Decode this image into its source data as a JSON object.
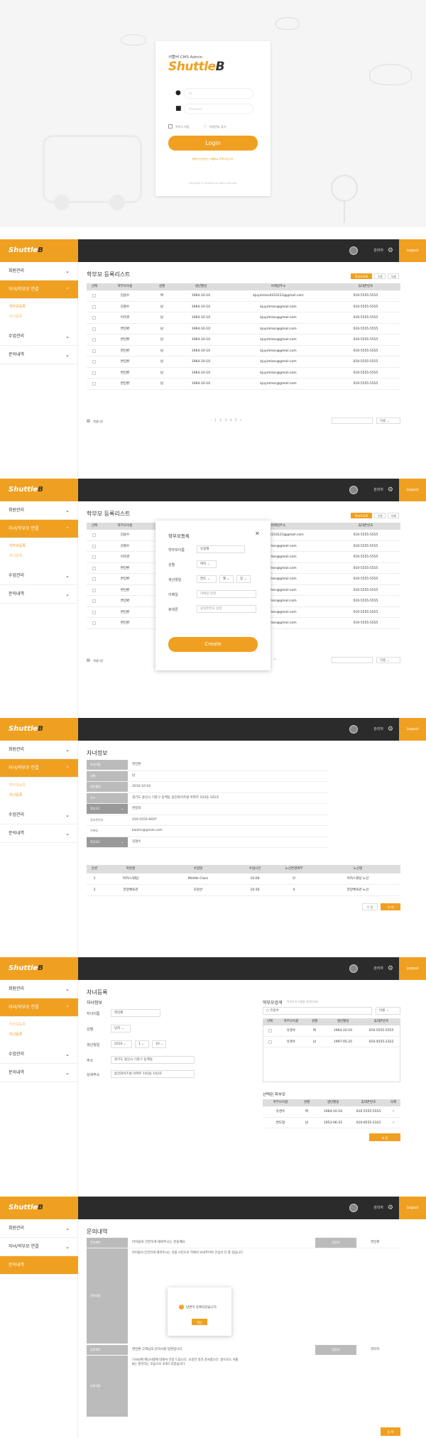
{
  "login": {
    "subtitle": "셔틀버 CMS Admin",
    "logo_a": "Shuttle",
    "logo_b": "B",
    "id_placeholder": "ID",
    "pw_placeholder": "Password",
    "remember": "아이디 저장",
    "find": "비밀번호 찾기",
    "button": "Login",
    "notice": "회원가입 문의는 셔틀B로 부탁드립니다.",
    "footer": "Copyright © ShuttleB All rights reserved."
  },
  "header": {
    "logo_a": "Shuttle",
    "logo_b": "B",
    "admin": "관리자",
    "logout": "Logout"
  },
  "sidebar": {
    "members": "회원관리",
    "link": "자녀/학부모 연결",
    "sub_parent": "학부모등록",
    "sub_child": "자녀등록",
    "classes": "수업관리",
    "inquiry": "문의내역"
  },
  "parents": {
    "title": "학부모 등록리스트",
    "btn_register": "학부모등록",
    "btn_edit": "수정",
    "btn_delete": "삭제",
    "columns": [
      "선택",
      "학부모이름",
      "성별",
      "생년월일",
      "이메일주소",
      "휴대폰번호"
    ],
    "rows": [
      [
        "김용수",
        "여",
        "1964-10-10",
        "kjuyimlsss0210123@gmail.com",
        "010-5555-5555"
      ],
      [
        "김철수",
        "남",
        "1964-10-10",
        "kjuyimlsss@gmail.com",
        "010-5555-5555"
      ],
      [
        "이하경",
        "남",
        "1964-10-10",
        "kjuyimlsss@gmail.com",
        "010-5555-5555"
      ],
      [
        "변민환",
        "남",
        "1964-10-10",
        "kjuyimlsss@gmail.com",
        "010-5555-5555"
      ],
      [
        "변민환",
        "남",
        "1964-10-10",
        "kjuyimlsss@gmail.com",
        "010-5555-5555"
      ],
      [
        "변민환",
        "남",
        "1964-10-10",
        "kjuyimlsss@gmail.com",
        "010-5555-5555"
      ],
      [
        "변민환",
        "남",
        "1964-10-10",
        "kjuyimlsss@gmail.com",
        "010-5555-5555"
      ],
      [
        "변민환",
        "남",
        "1964-10-10",
        "kjuyimlsss@gmail.com",
        "010-5555-5555"
      ],
      [
        "변민환",
        "남",
        "1964-10-10",
        "kjuyimlsss@gmail.com",
        "010-5555-5555"
      ]
    ],
    "excel": "엑셀다운",
    "pages": [
      "‹",
      "1",
      "2",
      "3",
      "4",
      "5",
      "›"
    ],
    "search_select": "이름"
  },
  "modal": {
    "title": "학부모등록",
    "name_label": "학부모이름",
    "name_value": "유용재",
    "gender_label": "성별",
    "gender_value": "여자",
    "birth_label": "생년월일",
    "birth_y": "연도",
    "birth_m": "월",
    "birth_d": "일",
    "email_label": "이메일",
    "email_ph": "이메일 입력",
    "phone_label": "휴대폰",
    "phone_ph": "휴대폰번호 입력",
    "create": "Create"
  },
  "child_info": {
    "title": "자녀정보",
    "rows": [
      [
        "자녀이름",
        "변민환"
      ],
      [
        "성별",
        "남"
      ],
      [
        "생년월일",
        "2010-10-10"
      ],
      [
        "주소",
        "경기도 용인시 기흥구 동백동 용인와이즈빌 아파트 103동 102호"
      ],
      [
        "학부모1",
        "변정희"
      ],
      [
        "휴대폰번호",
        "010-5555-6697"
      ],
      [
        "이메일",
        "bwzhn@gmail.com"
      ],
      [
        "학부모2",
        "김철수"
      ]
    ],
    "sched_cols": [
      "순번",
      "학원명",
      "수업명",
      "수업시간",
      "노선변경여부",
      "노선명"
    ],
    "sched_rows": [
      [
        "1",
        "아카스/휘탕",
        "Middle Class",
        "10:00",
        "O",
        "아카스휘탕 노선"
      ],
      [
        "2",
        "한양체육관",
        "초등반",
        "10:30",
        "X",
        "한양체육관 노선"
      ]
    ],
    "edit": "수 정",
    "delete": "삭 제"
  },
  "child_reg": {
    "title": "자녀등록",
    "section": "자녀정보",
    "name_label": "자녀이름",
    "name_value": "변민환",
    "gender_label": "성별",
    "gender_value": "남자",
    "birth_label": "생년월일",
    "birth_y": "2010",
    "birth_m": "1",
    "birth_d": "10",
    "addr_label": "주소",
    "addr_value": "경기도 용인시 기흥구 동백동",
    "detail_label": "상세주소",
    "detail_value": "용인와이즈빌 아파트 103동 102호",
    "search_title": "학부모검색",
    "search_hint": "학부모의 이름을 입력하세요",
    "search_value": "유용수",
    "search_select": "이름",
    "res_cols": [
      "선택",
      "학부모이름",
      "성별",
      "생년월일",
      "휴대폰번호"
    ],
    "res_rows": [
      [
        "유경수",
        "여",
        "1964-10-10",
        "010-5555-5555"
      ],
      [
        "유경수",
        "남",
        "1997-05-25",
        "010-4555-2322"
      ]
    ],
    "sel_title": "선택된 학부모",
    "sel_cols": [
      "학부모이름",
      "성별",
      "생년월일",
      "휴대폰번호",
      "삭제"
    ],
    "sel_rows": [
      [
        "유경수",
        "여",
        "1964-10-10",
        "010-5555-5555"
      ],
      [
        "변도형",
        "남",
        "1953-06-25",
        "010-8555-2322"
      ]
    ],
    "save": "저 장"
  },
  "inquiry": {
    "title": "문의내역",
    "q1_label": "문의제목",
    "q1_value": "아이들의 안전하게 태워주시는 분들께요",
    "status_label": "답변자",
    "status_value": "변민환",
    "c1_label": "문의내용",
    "c1_value": "아이들의 안전하게 태워주시는 것을 시민으로 역에서 보내주어야 안심이 더 잘 감습니다.",
    "q2_label": "답변제목",
    "q2_value": "변민환 고객님의 문의사항 답변입니다.",
    "st2_label": "답변자",
    "st2_value": "관리자",
    "c2_label": "답변내용",
    "c2_value": "기사님께 해당사항에 대해서 전달 드립니다. 소중한 의견 감사합니다. 앞으로도 셔틀B는 발전하는 모습으로 보여드리겠습니다.",
    "alert_msg": "답변이 등록되었습니다.",
    "alert_ok": "확인",
    "submit": "등 록"
  }
}
